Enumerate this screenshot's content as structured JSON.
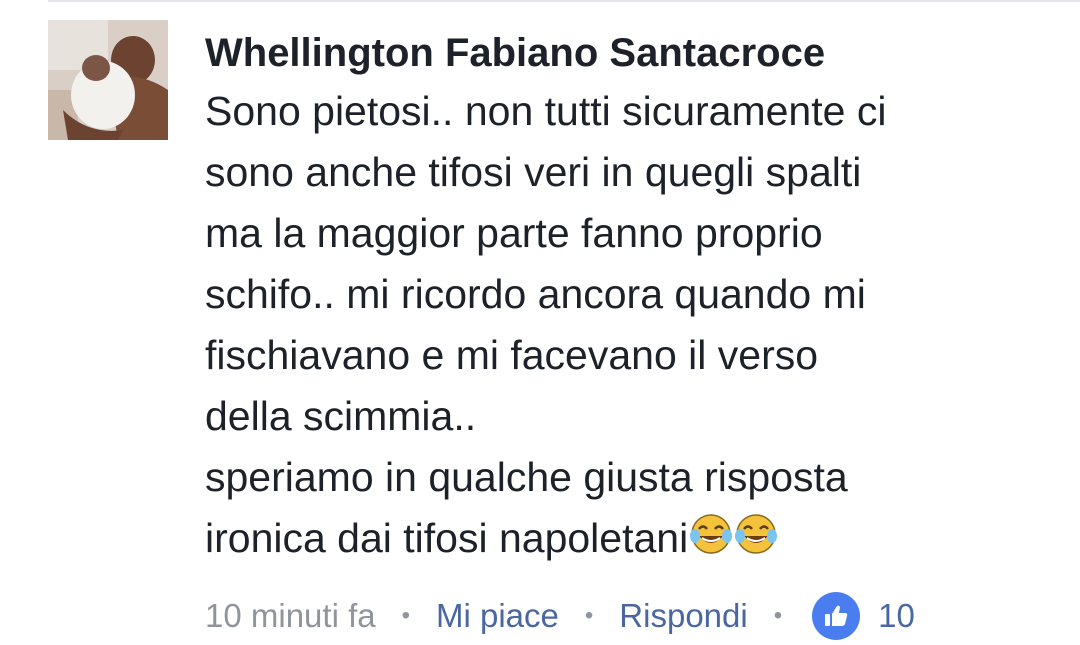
{
  "comment": {
    "author": "Whellington Fabiano Santacroce",
    "lines": [
      "Sono pietosi.. non tutti sicuramente ci",
      "sono anche tifosi veri in quegli spalti",
      "ma la maggior parte fanno proprio",
      "schifo.. mi ricordo ancora quando mi",
      "fischiavano e mi facevano il verso",
      "della scimmia..",
      "speriamo in qualche giusta risposta",
      "ironica dai tifosi napoletani"
    ],
    "emojis": [
      "tears-of-joy-emoji",
      "tears-of-joy-emoji"
    ]
  },
  "actions": {
    "time": "10 minuti fa",
    "separator": "•",
    "like_label": "Mi piace",
    "reply_label": "Rispondi",
    "like_count": "10"
  },
  "colors": {
    "text": "#1d2129",
    "muted": "#90949c",
    "link": "#4b67a1",
    "like_badge": "#4a7ef0"
  }
}
